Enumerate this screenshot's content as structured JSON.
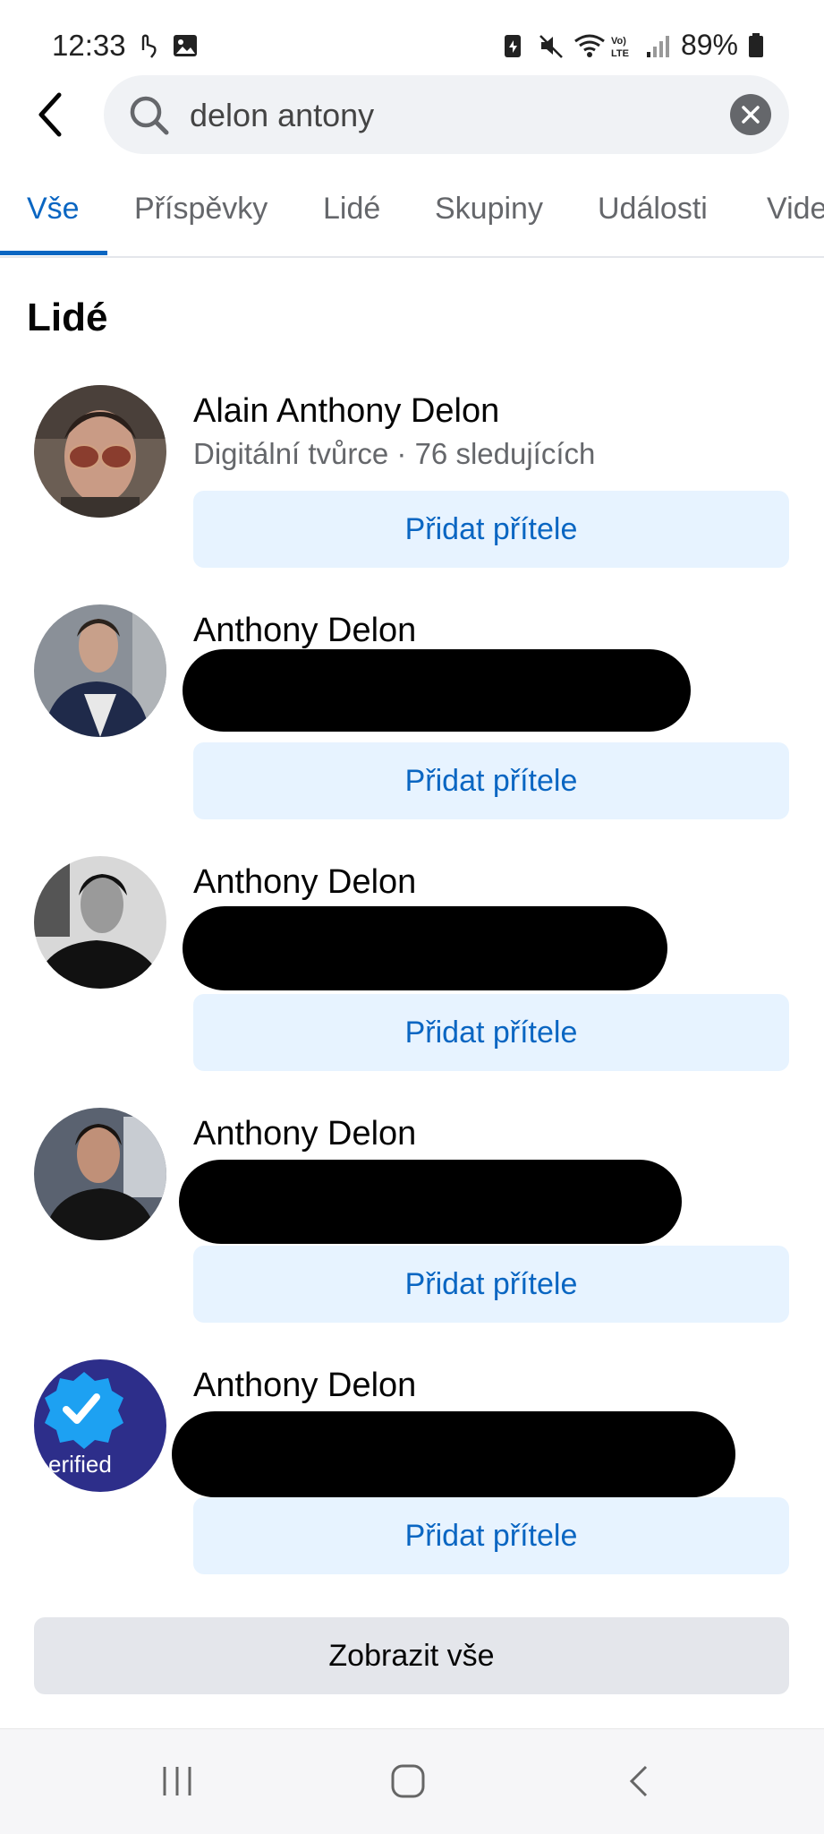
{
  "status_bar": {
    "time": "12:33",
    "battery": "89%",
    "icons": [
      "touch-icon",
      "image-icon",
      "battery-saver-icon",
      "mute-icon",
      "wifi-icon",
      "volte-icon",
      "signal-icon",
      "battery-icon"
    ]
  },
  "search": {
    "query": "delon antony"
  },
  "tabs": [
    {
      "label": "Vše",
      "active": true
    },
    {
      "label": "Příspěvky",
      "active": false
    },
    {
      "label": "Lidé",
      "active": false
    },
    {
      "label": "Skupiny",
      "active": false
    },
    {
      "label": "Události",
      "active": false
    },
    {
      "label": "Vide",
      "active": false
    }
  ],
  "section": {
    "title": "Lidé"
  },
  "people": [
    {
      "name": "Alain Anthony Delon",
      "subtitle": "Digitální tvůrce · 76 sledujících",
      "button": "Přidat přítele",
      "avatar": "photo-man-sunglasses"
    },
    {
      "name": "Anthony Delon",
      "subtitle": "",
      "button": "Přidat přítele",
      "avatar": "photo-man-jacket"
    },
    {
      "name": "Anthony Delon",
      "subtitle": "",
      "button": "Přidat přítele",
      "avatar": "photo-man-bw"
    },
    {
      "name": "Anthony Delon",
      "subtitle": "",
      "button": "Přidat přítele",
      "avatar": "photo-man-event"
    },
    {
      "name": "Anthony Delon",
      "subtitle": "",
      "button": "Přidat přítele",
      "avatar": "verified-badge",
      "avatar_text": "erified"
    }
  ],
  "show_all": "Zobrazit vše",
  "colors": {
    "accent": "#0a66c2",
    "button_bg": "#e7f3ff",
    "secondary_text": "#65676b"
  }
}
